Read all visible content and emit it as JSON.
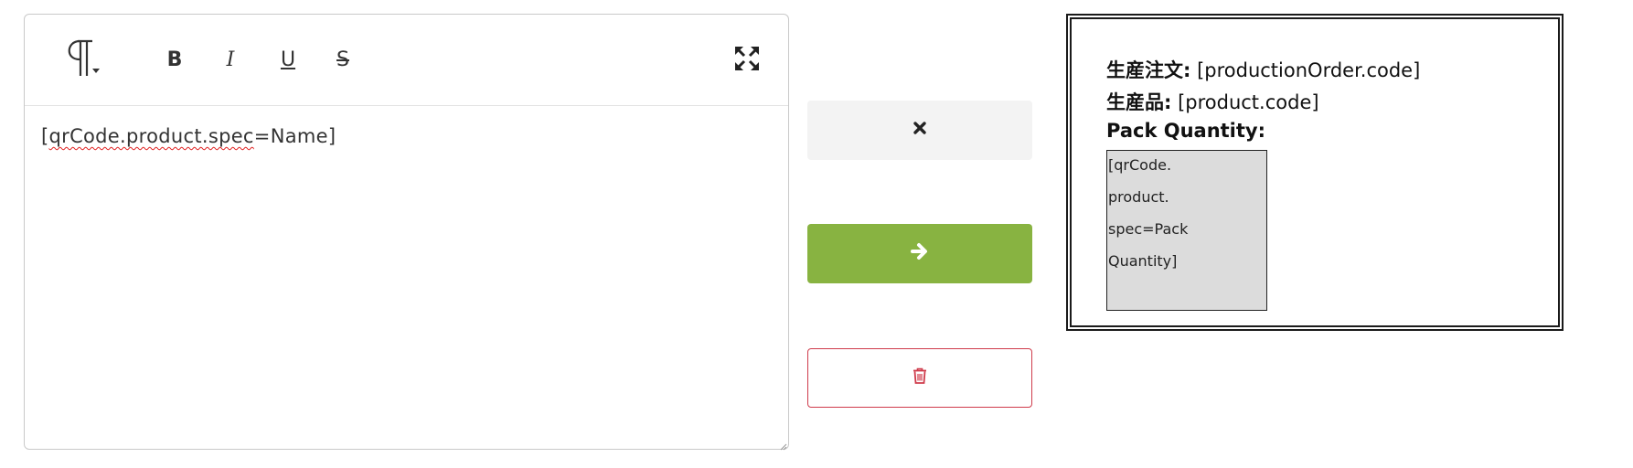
{
  "editor": {
    "toolbar": {
      "paragraph_icon": "paragraph-icon",
      "bold_label": "B",
      "italic_label": "I",
      "underline_label": "U",
      "strikethrough_label": "S",
      "fullscreen_icon": "expand-icon"
    },
    "content": {
      "prefix": "[",
      "misspelled": "qrCode.product.spec",
      "suffix": "=Name]"
    }
  },
  "actions": {
    "cancel_icon": "close-icon",
    "next_icon": "arrow-right-icon",
    "delete_icon": "trash-icon"
  },
  "preview": {
    "lines": [
      {
        "label": "生産注文:",
        "value": " [productionOrder.code]"
      },
      {
        "label": "生産品:",
        "value": " [product.code]"
      },
      {
        "label": "Pack Quantity:",
        "value": ""
      }
    ],
    "box_lines": [
      "[qrCode.",
      "product.",
      "spec=Pack",
      "Quantity]"
    ]
  },
  "colors": {
    "next_button": "#88b341",
    "delete_border": "#cf3b4b",
    "cancel_bg": "#f3f3f3",
    "preview_box_bg": "#dcdcdc"
  }
}
